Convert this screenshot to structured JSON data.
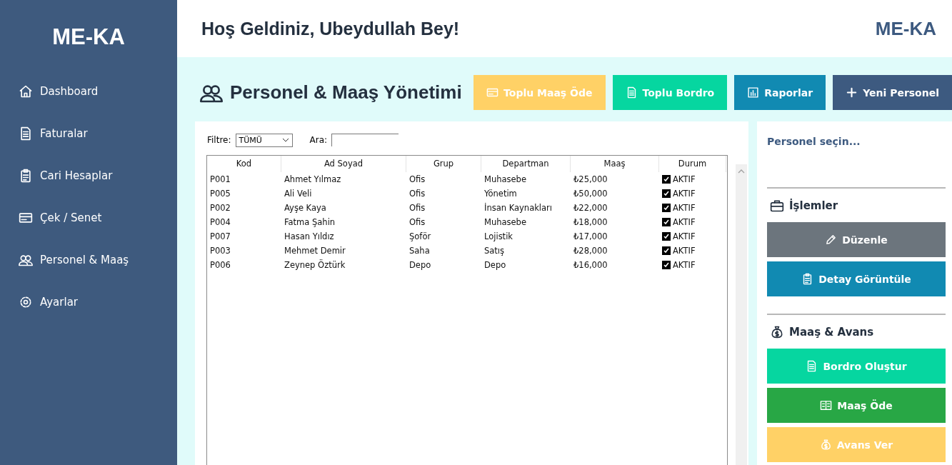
{
  "sidebar": {
    "logo": "ME-KA",
    "items": [
      {
        "label": "Dashboard"
      },
      {
        "label": "Faturalar"
      },
      {
        "label": "Cari Hesaplar"
      },
      {
        "label": "Çek / Senet"
      },
      {
        "label": "Personel & Maaş"
      },
      {
        "label": "Ayarlar"
      }
    ]
  },
  "header": {
    "greeting": "Hoş Geldiniz, Ubeydullah Bey!",
    "brand": "ME-KA"
  },
  "page_title": "Personel & Maaş Yönetimi",
  "toolbar": [
    {
      "label": "Toplu Maaş Öde",
      "color": "#ffd166"
    },
    {
      "label": "Toplu Bordro",
      "color": "#06d6a0"
    },
    {
      "label": "Raporlar",
      "color": "#118ab2"
    },
    {
      "label": "Yeni Personel",
      "color": "#3d5a80"
    }
  ],
  "filter": {
    "label": "Filtre:",
    "value": "TÜMÜ"
  },
  "search": {
    "label": "Ara:"
  },
  "table": {
    "columns": [
      "Kod",
      "Ad Soyad",
      "Grup",
      "Departman",
      "Maaş",
      "Durum"
    ],
    "rows": [
      {
        "kod": "P001",
        "name": "Ahmet Yılmaz",
        "group": "Ofis",
        "dept": "Muhasebe",
        "salary": "₺25,000",
        "status": "AKTIF",
        "checked": true
      },
      {
        "kod": "P005",
        "name": "Ali Veli",
        "group": "Ofis",
        "dept": "Yönetim",
        "salary": "₺50,000",
        "status": "AKTIF",
        "checked": true
      },
      {
        "kod": "P002",
        "name": "Ayşe Kaya",
        "group": "Ofis",
        "dept": "İnsan Kaynakları",
        "salary": "₺22,000",
        "status": "AKTIF",
        "checked": true
      },
      {
        "kod": "P004",
        "name": "Fatma Şahin",
        "group": "Ofis",
        "dept": "Muhasebe",
        "salary": "₺18,000",
        "status": "AKTIF",
        "checked": true
      },
      {
        "kod": "P007",
        "name": "Hasan Yıldız",
        "group": "Şoför",
        "dept": "Lojistik",
        "salary": "₺17,000",
        "status": "AKTIF",
        "checked": true
      },
      {
        "kod": "P003",
        "name": "Mehmet Demir",
        "group": "Saha",
        "dept": "Satış",
        "salary": "₺28,000",
        "status": "AKTIF",
        "checked": true
      },
      {
        "kod": "P006",
        "name": "Zeynep Öztürk",
        "group": "Depo",
        "dept": "Depo",
        "salary": "₺16,000",
        "status": "AKTIF",
        "checked": true
      }
    ]
  },
  "details": {
    "placeholder_text": "Personel seçin...",
    "sections": [
      {
        "title": "İşlemler",
        "buttons": [
          {
            "label": "Düzenle",
            "color": "#6c757d"
          },
          {
            "label": "Detay Görüntüle",
            "color": "#118ab2"
          }
        ]
      },
      {
        "title": "Maaş & Avans",
        "buttons": [
          {
            "label": "Bordro Oluştur",
            "color": "#06d6a0"
          },
          {
            "label": "Maaş Öde",
            "color": "#28a745"
          },
          {
            "label": "Avans Ver",
            "color": "#ffd166"
          }
        ]
      }
    ]
  }
}
